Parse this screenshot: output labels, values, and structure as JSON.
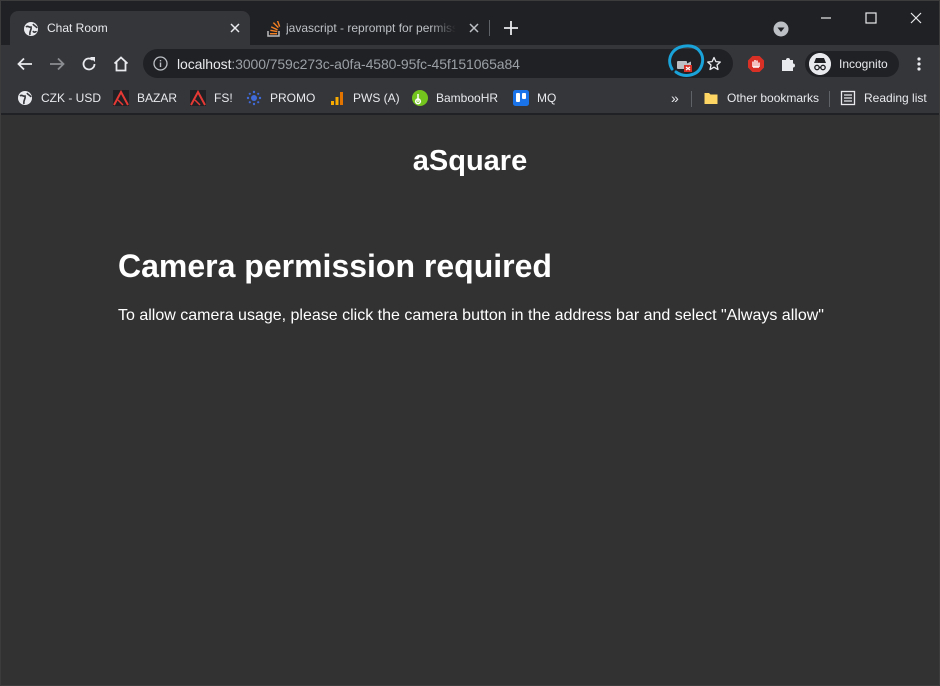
{
  "tabs": [
    {
      "title": "Chat Room",
      "active": true
    },
    {
      "title": "javascript - reprompt for permissions",
      "active": false
    }
  ],
  "address_bar": {
    "host": "localhost",
    "path": ":3000/759c273c-a0fa-4580-95fc-45f151065a84"
  },
  "profile": {
    "label": "Incognito"
  },
  "bookmarks": [
    {
      "label": "CZK - USD",
      "icon": "globe-icon"
    },
    {
      "label": "BAZAR",
      "icon": "red-logo-icon"
    },
    {
      "label": "FS!",
      "icon": "red-logo-icon"
    },
    {
      "label": "PROMO",
      "icon": "blue-dots-icon"
    },
    {
      "label": "PWS (A)",
      "icon": "bar-chart-icon"
    },
    {
      "label": "BambooHR",
      "icon": "bamboohr-icon"
    },
    {
      "label": "MQ",
      "icon": "trello-icon"
    }
  ],
  "bookmarks_overflow": "»",
  "other_bookmarks": "Other bookmarks",
  "reading_list": "Reading list",
  "page": {
    "brand": "aSquare",
    "heading": "Camera permission required",
    "message": "To allow camera usage, please click the camera button in the address bar and select \"Always allow\""
  },
  "colors": {
    "page_background": "#323232",
    "toolbar": "#35363a",
    "frame": "#202124",
    "annotation_circle": "#1aa3d9",
    "camera_blocked": "#d93025"
  }
}
